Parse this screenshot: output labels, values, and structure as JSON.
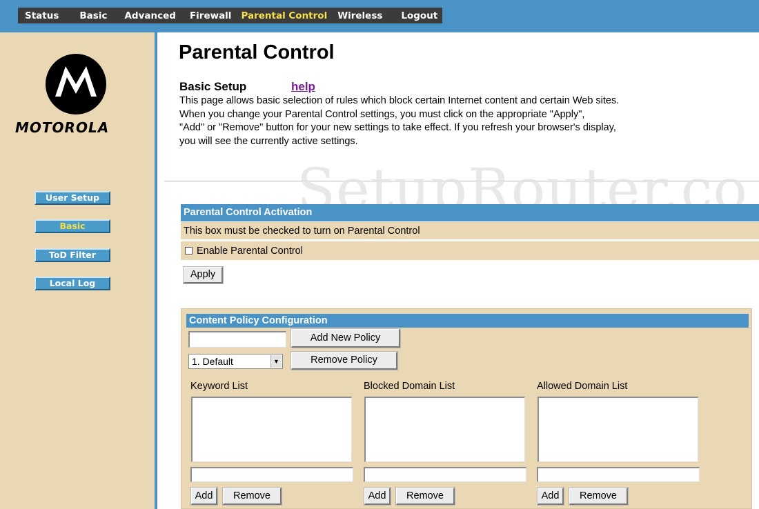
{
  "topnav": {
    "items": [
      {
        "label": "Status"
      },
      {
        "label": "Basic"
      },
      {
        "label": "Advanced"
      },
      {
        "label": "Firewall"
      },
      {
        "label": "Parental Control",
        "active": true
      },
      {
        "label": "Wireless"
      },
      {
        "label": "Logout"
      }
    ]
  },
  "sidebar": {
    "logo_text": "MOTOROLA",
    "buttons": [
      {
        "label": "User Setup"
      },
      {
        "label": "Basic",
        "active": true
      },
      {
        "label": "ToD Filter"
      },
      {
        "label": "Local Log"
      }
    ]
  },
  "main": {
    "title": "Parental Control",
    "section_heading": "Basic Setup",
    "help_link": "help",
    "description_lines": [
      "This page allows basic selection of rules which block certain Internet content and certain Web sites.",
      "When you change your Parental Control settings, you must click on the appropriate \"Apply\",",
      "\"Add\" or \"Remove\" button for your new settings to take effect. If you refresh your browser's display,",
      "you will see the currently active settings."
    ],
    "watermark": "SetupRouter.co"
  },
  "activation": {
    "header": "Parental Control Activation",
    "note": "This box must be checked to turn on Parental Control",
    "checkbox_label": "Enable Parental Control",
    "checkbox_checked": false,
    "apply_label": "Apply"
  },
  "content_policy": {
    "header": "Content Policy Configuration",
    "new_policy_value": "",
    "add_policy_label": "Add New Policy",
    "selected_policy": "1. Default",
    "remove_policy_label": "Remove Policy",
    "lists": [
      {
        "label": "Keyword List",
        "add_label": "Add",
        "remove_label": "Remove"
      },
      {
        "label": "Blocked Domain List",
        "add_label": "Add",
        "remove_label": "Remove"
      },
      {
        "label": "Allowed Domain List",
        "add_label": "Add",
        "remove_label": "Remove"
      }
    ]
  },
  "colors": {
    "nav_blue": "#4a93c6",
    "sidebar_tan": "#ead8b4",
    "nav_dark": "#3b3b3b",
    "active_yellow": "#f6e04a"
  }
}
